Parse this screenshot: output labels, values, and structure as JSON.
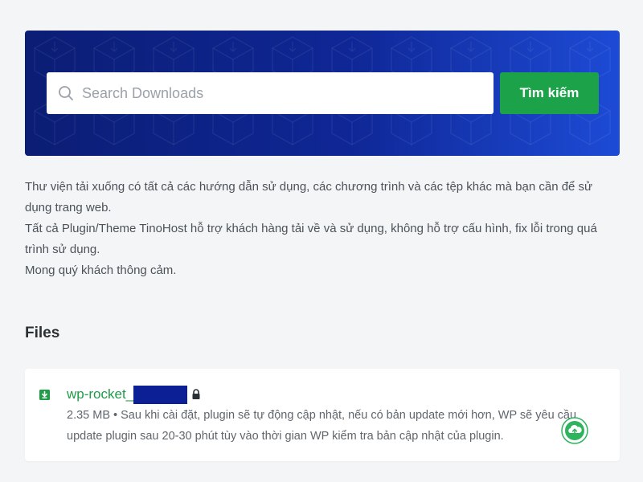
{
  "search": {
    "placeholder": "Search Downloads",
    "button_label": "Tìm kiếm"
  },
  "description": {
    "line1": "Thư viện tải xuống có tất cả các hướng dẫn sử dụng, các chương trình và các tệp khác mà bạn cần để sử dụng trang web.",
    "line2": "Tất cả Plugin/Theme TinoHost hỗ trợ khách hàng tải về và sử dụng, không hỗ trợ cấu hình, fix lỗi trong quá trình sử dụng.",
    "line3": "Mong quý khách thông cảm."
  },
  "files": {
    "heading": "Files",
    "items": [
      {
        "name": "wp-rocket_",
        "meta": "2.35 MB • Sau khi cài đặt, plugin sẽ tự động cập nhật, nếu có bản update mới hơn, WP sẽ yêu cầu update plugin sau 20-30 phút tùy vào thời gian WP kiểm tra bản cập nhật của plugin.",
        "icon": "download-icon",
        "lock_icon": "lock-icon"
      }
    ]
  },
  "colors": {
    "hero_gradient_start": "#0b1d74",
    "hero_gradient_end": "#1d4bd6",
    "accent_green": "#1ca34a",
    "link_green": "#1e9c47"
  }
}
